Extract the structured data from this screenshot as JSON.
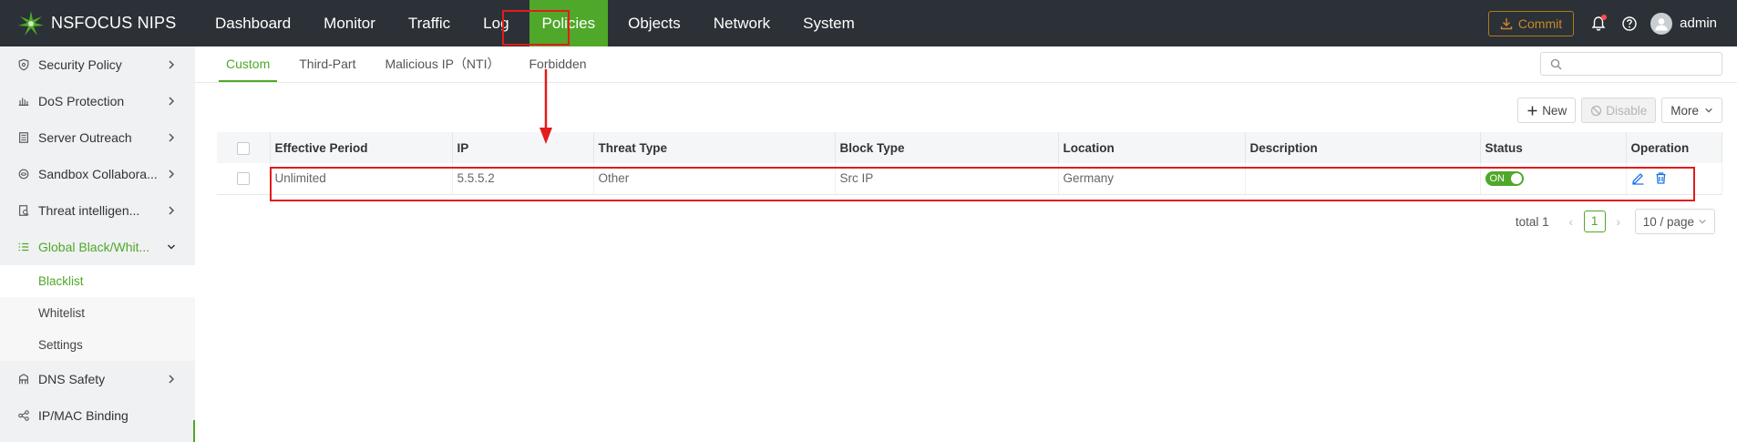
{
  "brand": {
    "name": "NSFOCUS NIPS"
  },
  "nav": {
    "items": [
      {
        "label": "Dashboard",
        "active": false
      },
      {
        "label": "Monitor",
        "active": false
      },
      {
        "label": "Traffic",
        "active": false
      },
      {
        "label": "Log",
        "active": false
      },
      {
        "label": "Policies",
        "active": true
      },
      {
        "label": "Objects",
        "active": false
      },
      {
        "label": "Network",
        "active": false
      },
      {
        "label": "System",
        "active": false
      }
    ]
  },
  "topright": {
    "commit_label": "Commit",
    "user_name": "admin",
    "icons": [
      "download-icon",
      "bell-icon",
      "help-icon",
      "user-avatar-icon"
    ]
  },
  "sidebar": {
    "items": [
      {
        "label": "Security Policy",
        "icon": "shield-icon"
      },
      {
        "label": "DoS Protection",
        "icon": "dos-icon"
      },
      {
        "label": "Server Outreach",
        "icon": "server-icon"
      },
      {
        "label": "Sandbox Collabora...",
        "icon": "sandbox-icon"
      },
      {
        "label": "Threat intelligen...",
        "icon": "threat-icon"
      },
      {
        "label": "Global Black/Whit...",
        "icon": "list-icon",
        "expanded": true
      }
    ],
    "subitems": [
      {
        "label": "Blacklist",
        "active": true
      },
      {
        "label": "Whitelist",
        "active": false
      },
      {
        "label": "Settings",
        "active": false
      }
    ],
    "bottom_items": [
      {
        "label": "DNS Safety",
        "icon": "dns-icon"
      },
      {
        "label": "IP/MAC Binding",
        "icon": "binding-icon"
      }
    ]
  },
  "tabs": [
    {
      "label": "Custom",
      "active": true
    },
    {
      "label": "Third-Part",
      "active": false
    },
    {
      "label": "Malicious IP（NTI）",
      "active": false
    },
    {
      "label": "Forbidden",
      "active": false
    }
  ],
  "search": {
    "placeholder": "",
    "value": ""
  },
  "toolbar": {
    "new_label": "New",
    "disable_label": "Disable",
    "more_label": "More"
  },
  "table": {
    "columns": [
      "Effective Period",
      "IP",
      "Threat Type",
      "Block Type",
      "Location",
      "Description",
      "Status",
      "Operation"
    ],
    "rows": [
      {
        "effective_period": "Unlimited",
        "ip": "5.5.5.2",
        "threat_type": "Other",
        "block_type": "Src IP",
        "location": "Germany",
        "description": "",
        "status": "ON"
      }
    ]
  },
  "pager": {
    "total_label": "total 1",
    "current_page": "1",
    "page_size": "10 / page"
  },
  "colors": {
    "accent": "#4fa82a",
    "topbar": "#2b3136",
    "annotation": "#e31b1b",
    "commit": "#c8892a"
  }
}
